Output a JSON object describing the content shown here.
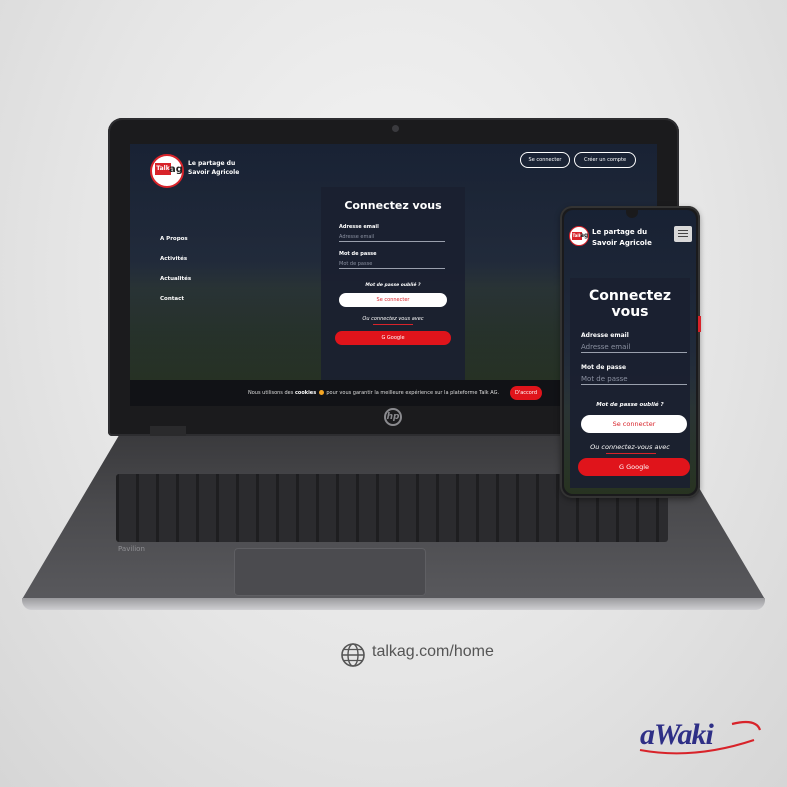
{
  "laptop_site": {
    "logo": {
      "talk": "Talk",
      "ag": "ag"
    },
    "tagline": [
      "Le partage du",
      "Savoir Agricole"
    ],
    "header_buttons": [
      "Se connecter",
      "Créer un compte"
    ],
    "nav": [
      "A Propos",
      "Activités",
      "Actualités",
      "Contact"
    ],
    "login": {
      "title": "Connectez vous",
      "email_label": "Adresse email",
      "email_placeholder": "Adresse email",
      "password_label": "Mot de passe",
      "password_placeholder": "Mot de passe",
      "forgot": "Mot de passe oublié ?",
      "submit": "Se connecter",
      "or_text": "Ou connectez vous avec",
      "google": "Google"
    },
    "cookie": {
      "text_before": "Nous utilisons des",
      "bold": "cookies",
      "text_after": "pour vous garantir la meilleure expérience sur la plateforme Talk AG.",
      "button": "D'accord"
    },
    "brand_label": "Pavilion"
  },
  "phone_site": {
    "logo": {
      "talk": "Talk",
      "ag": "ag"
    },
    "tagline": [
      "Le partage du",
      "Savoir Agricole"
    ],
    "login": {
      "title": [
        "Connectez",
        "vous"
      ],
      "email_label": "Adresse email",
      "email_placeholder": "Adresse email",
      "password_label": "Mot de passe",
      "password_placeholder": "Mot de passe",
      "forgot": "Mot de passe oublié ?",
      "submit": "Se connecter",
      "or_text": "Ou connectez-vous avec",
      "google": "Google"
    }
  },
  "footer": {
    "url": "talkag.com/home",
    "brand": "aWaki"
  },
  "colors": {
    "accent_red": "#e0141b",
    "card_bg": "#1a1f30",
    "brand_blue": "#2e2f86"
  }
}
